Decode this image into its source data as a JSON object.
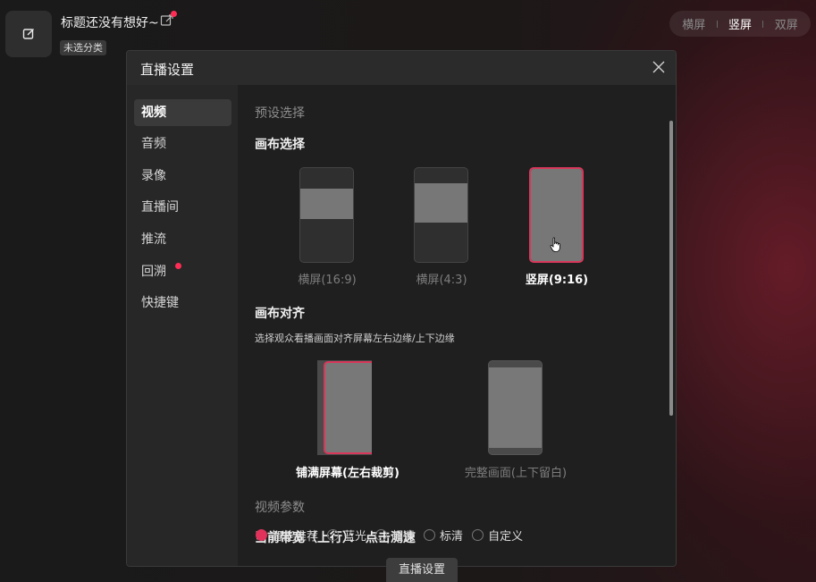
{
  "header": {
    "title": "标题还没有想好~",
    "category": "未选分类",
    "modes": [
      "横屏",
      "竖屏",
      "双屏"
    ],
    "active_mode": "竖屏"
  },
  "modal": {
    "title": "直播设置",
    "nav": [
      "视频",
      "音频",
      "录像",
      "直播间",
      "推流",
      "回溯",
      "快捷键"
    ],
    "active_nav": "视频",
    "preset_label": "预设选择",
    "canvas_select_label": "画布选择",
    "canvas_options": [
      "横屏(16:9)",
      "横屏(4:3)",
      "竖屏(9:16)"
    ],
    "selected_canvas": "竖屏(9:16)",
    "align_label": "画布对齐",
    "align_desc": "选择观众看播画面对齐屏幕左右边缘/上下边缘",
    "align_options": [
      "铺满屏幕(左右裁剪)",
      "完整画面(上下留白)"
    ],
    "video_params_label": "视频参数",
    "bandwidth_label": "当前带宽（上行）：",
    "bandwidth_link": "点击测速",
    "quality_options": [
      "智能推荐",
      "蓝光",
      "超清",
      "标清",
      "自定义"
    ]
  },
  "bottom_button": "直播设置",
  "colors": {
    "accent": "#e0325a",
    "background": "#1f1f1f"
  }
}
